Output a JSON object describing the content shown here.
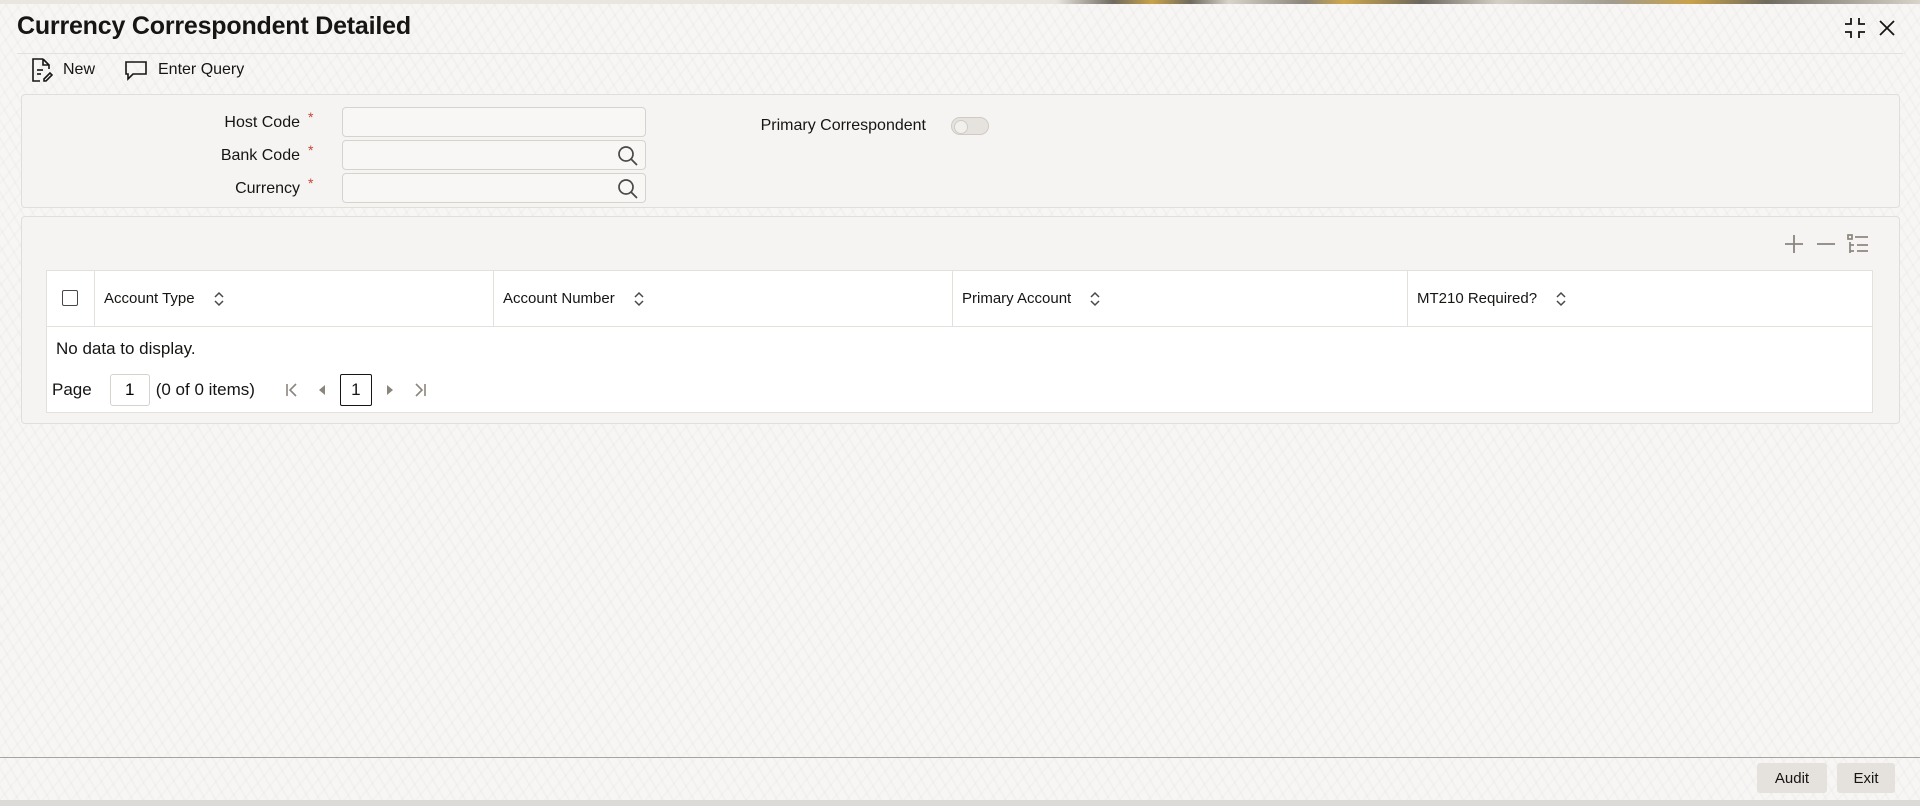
{
  "window": {
    "title": "Currency Correspondent Detailed",
    "controls": [
      "collapse-icon",
      "close-icon"
    ]
  },
  "toolbar": {
    "new_label": "New",
    "enter_query_label": "Enter Query"
  },
  "form": {
    "host_code": {
      "label": "Host Code",
      "required_mark": "*",
      "value": ""
    },
    "bank_code": {
      "label": "Bank Code",
      "required_mark": "*",
      "value": ""
    },
    "currency": {
      "label": "Currency",
      "required_mark": "*",
      "value": ""
    },
    "primary_correspondent": {
      "label": "Primary Correspondent",
      "checked": false
    }
  },
  "grid": {
    "tools": [
      "add-row-icon",
      "delete-row-icon",
      "single-record-view-icon"
    ],
    "columns": [
      "Account Type",
      "Account Number",
      "Primary Account",
      "MT210 Required?"
    ],
    "rows": [],
    "empty_text": "No data to display.",
    "pager": {
      "page_label": "Page",
      "page_value": "1",
      "items_text": "(0 of 0 items)",
      "current_page": "1"
    }
  },
  "footer": {
    "audit_label": "Audit",
    "exit_label": "Exit"
  },
  "colors": {
    "required": "#c74634",
    "text": "#161513",
    "panel_bg": "#f5f4f2"
  }
}
